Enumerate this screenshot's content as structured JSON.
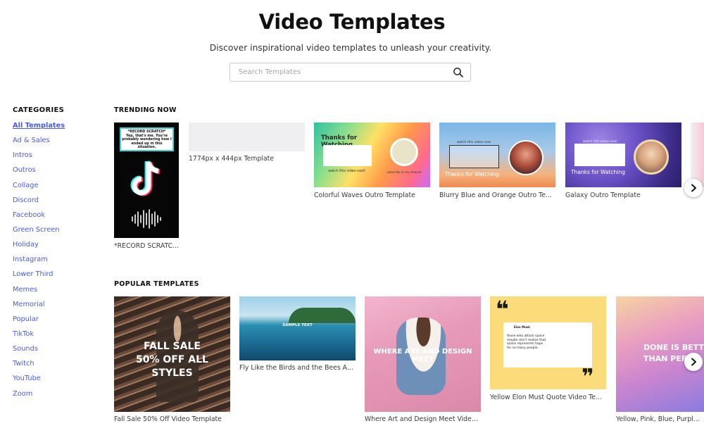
{
  "header": {
    "title": "Video Templates",
    "subtitle": "Discover inspirational video templates to unleash your creativity."
  },
  "search": {
    "placeholder": "Search Templates",
    "value": ""
  },
  "sidebar": {
    "heading": "CATEGORIES",
    "items": [
      {
        "label": "All Templates",
        "active": true
      },
      {
        "label": "Ad & Sales"
      },
      {
        "label": "Intros"
      },
      {
        "label": "Outros"
      },
      {
        "label": "Collage"
      },
      {
        "label": "Discord"
      },
      {
        "label": "Facebook"
      },
      {
        "label": "Green Screen"
      },
      {
        "label": "Holiday"
      },
      {
        "label": "Instagram"
      },
      {
        "label": "Lower Third"
      },
      {
        "label": "Memes"
      },
      {
        "label": "Memorial"
      },
      {
        "label": "Popular"
      },
      {
        "label": "TikTok"
      },
      {
        "label": "Sounds"
      },
      {
        "label": "Twitch"
      },
      {
        "label": "YouTube"
      },
      {
        "label": "Zoom"
      }
    ]
  },
  "trending": {
    "title": "TRENDING NOW",
    "items": [
      {
        "caption": "*RECORD SCRATC...",
        "thumb_text": "*RECORD SCRATCH*\nYep, that's me. You're probably wondering how I ended up in this situation."
      },
      {
        "caption": "1774px x 444px Template"
      },
      {
        "caption": "Colorful Waves Outro Template",
        "thumb_text": "Thanks for Watching",
        "thumb_small": "watch this video next!",
        "thumb_small2": "subscribe to my channel"
      },
      {
        "caption": "Blurry Blue and Orange Outro Te...",
        "thumb_text": "Thanks for Watching",
        "thumb_small": "watch this video next"
      },
      {
        "caption": "Galaxy Outro Template",
        "thumb_text": "Thanks for Watching",
        "thumb_small": "watch this video next"
      }
    ]
  },
  "popular": {
    "title": "POPULAR TEMPLATES",
    "items": [
      {
        "caption": "Fall Sale 50% Off Video Template",
        "thumb_text": "FALL SALE\n50% OFF ALL STYLES"
      },
      {
        "caption": "Fly Like the Birds and the Bees Ae...",
        "thumb_text": "SAMPLE TEXT"
      },
      {
        "caption": "Where Art and Design Meet Video...",
        "thumb_text": "WHERE ART AND DESIGN MEET"
      },
      {
        "caption": "Yellow Elon Must Quote Video Te...",
        "tweet_name": "Elon Musk",
        "tweet_text": "those who attack space\nmaybe don't realize that\nspace represents hope\nfor so many people"
      },
      {
        "caption": "Yellow, Pink, Blue, Purpl...",
        "thumb_text": "DONE IS BETT\nTHAN PERF"
      }
    ]
  },
  "colors": {
    "link": "#4a5ae8"
  },
  "icons": {
    "search": "search-icon",
    "next": "chevron-right-icon"
  }
}
